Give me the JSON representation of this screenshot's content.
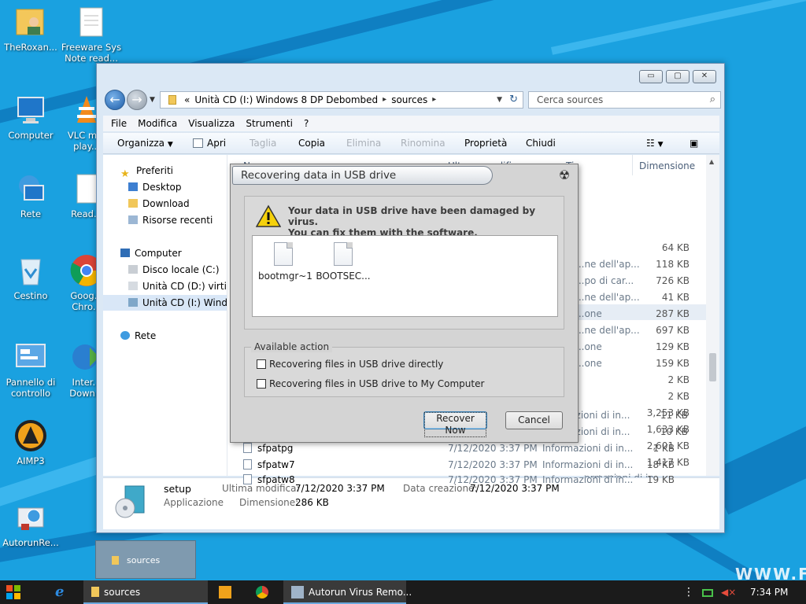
{
  "desktop": {
    "icons": [
      {
        "label": "TheRoxan...",
        "icon": "user-folder-icon"
      },
      {
        "label": "Freeware Sys Note read...",
        "icon": "text-file-icon"
      },
      {
        "label": "Computer",
        "icon": "computer-icon"
      },
      {
        "label": "VLC m... play...",
        "icon": "vlc-icon"
      },
      {
        "label": "Rete",
        "icon": "network-icon"
      },
      {
        "label": "Read...",
        "icon": "document-icon"
      },
      {
        "label": "Cestino",
        "icon": "recycle-bin-icon"
      },
      {
        "label": "Goog... Chro...",
        "icon": "chrome-icon"
      },
      {
        "label": "Pannello di controllo",
        "icon": "control-panel-icon"
      },
      {
        "label": "Inter... Down...",
        "icon": "internet-download-icon"
      },
      {
        "label": "AIMP3",
        "icon": "aimp-icon"
      },
      {
        "label": "AutorunRe...",
        "icon": "autorun-remover-icon"
      }
    ],
    "watermark": "WWW.FF"
  },
  "explorer": {
    "controls": {
      "minimize": "▭",
      "maximize": "▢",
      "close": "✕"
    },
    "address": {
      "prefix": "«",
      "segment1": "Unità CD (I:) Windows 8 DP Debombed",
      "segment2": "sources"
    },
    "search_placeholder": "Cerca sources",
    "menu": [
      "File",
      "Modifica",
      "Visualizza",
      "Strumenti",
      "?"
    ],
    "toolbar": {
      "organize": "Organizza",
      "open": "Apri",
      "cut": "Taglia",
      "copy": "Copia",
      "delete": "Elimina",
      "rename": "Rinomina",
      "properties": "Proprietà",
      "close": "Chiudi"
    },
    "nav": {
      "favorites": "Preferiti",
      "desktop": "Desktop",
      "download": "Download",
      "recent": "Risorse recenti",
      "computer": "Computer",
      "disk_c": "Disco locale (C:)",
      "cd_d": "Unità CD (D:) virtio-...",
      "cd_i": "Unità CD (I:) Window...",
      "network": "Rete"
    },
    "columns": {
      "name_partial": "N",
      "date_partial": "Ult... ...modific",
      "type_partial": "Ti",
      "size": "Dimensione"
    },
    "partial_types": [
      "...ne dell'ap...",
      "...po di car...",
      "...ne dell'ap...",
      "...one",
      "...ne dell'ap...",
      "...one",
      "...one"
    ],
    "sizes": [
      "64 KB",
      "118 KB",
      "726 KB",
      "41 KB",
      "287 KB",
      "697 KB",
      "129 KB",
      "159 KB",
      "2 KB",
      "2 KB",
      "3,253 KB",
      "1,633 KB",
      "2,601 KB",
      "1,417 KB",
      "11 KB",
      "10 KB"
    ],
    "lower_types": [
      "...ormazioni di in...",
      "...ormazioni di in..."
    ],
    "files": [
      {
        "name": "sfpatpg",
        "date": "7/12/2020 3:37 PM",
        "type": "Informazioni di in...",
        "size": "1 KB"
      },
      {
        "name": "sfpatw7",
        "date": "7/12/2020 3:37 PM",
        "type": "Informazioni di in...",
        "size": "18 KB"
      },
      {
        "name": "sfpatw8",
        "date": "7/12/2020 3:37 PM",
        "type": "Informazioni di in...",
        "size": "19 KB"
      }
    ],
    "details": {
      "name": "setup",
      "kind": "Applicazione",
      "modified_label": "Ultima modifica:",
      "modified_value": "7/12/2020 3:37 PM",
      "created_label": "Data creazione:",
      "created_value": "7/12/2020 3:37 PM",
      "size_label": "Dimensione:",
      "size_value": "286 KB"
    }
  },
  "dialog": {
    "title": "Recovering data in USB drive",
    "warning_line1": "Your data in USB drive have been damaged by virus.",
    "warning_line2": "You can fix them with the software.",
    "files": [
      "bootmgr~1",
      "BOOTSEC..."
    ],
    "group_label": "Available action",
    "option1": "Recovering files in USB drive directly",
    "option2": "Recovering files in USB drive to My Computer",
    "recover_label": "Recover Now",
    "cancel_label": "Cancel"
  },
  "thumbnail": {
    "label": "sources"
  },
  "taskbar": {
    "sources_label": "sources",
    "app_label": "Autorun Virus Remo...",
    "clock": "7:34 PM"
  }
}
